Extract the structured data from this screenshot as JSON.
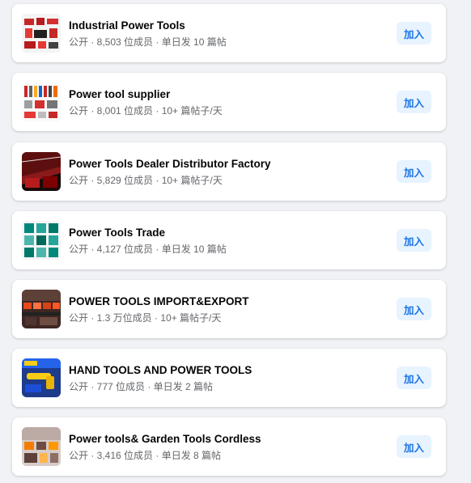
{
  "groups": [
    {
      "name": "Industrial Power Tools",
      "meta": "公开 · 8,503 位成员 · 单日发 10 篇帖",
      "join_label": "加入",
      "thumb_icon": "industrial-power-tools-photo"
    },
    {
      "name": "Power tool supplier",
      "meta": "公开 · 8,001 位成员 · 10+ 篇帖子/天",
      "join_label": "加入",
      "thumb_icon": "tool-assortment-photo"
    },
    {
      "name": "Power Tools Dealer Distributor Factory",
      "meta": "公开 · 5,829 位成员 · 10+ 篇帖子/天",
      "join_label": "加入",
      "thumb_icon": "red-factory-photo"
    },
    {
      "name": "Power Tools Trade",
      "meta": "公开 · 4,127 位成员 · 单日发 10 篇帖",
      "join_label": "加入",
      "thumb_icon": "power-tools-grid-photo"
    },
    {
      "name": "POWER TOOLS IMPORT&EXPORT",
      "meta": "公开 · 1.3 万位成员 · 10+ 篇帖子/天",
      "join_label": "加入",
      "thumb_icon": "factory-line-photo"
    },
    {
      "name": "HAND TOOLS AND POWER TOOLS",
      "meta": "公开 · 777 位成员 · 单日发 2 篇帖",
      "join_label": "加入",
      "thumb_icon": "tools-banner-photo"
    },
    {
      "name": "Power tools& Garden Tools Cordless",
      "meta": "公开 · 3,416 位成员 · 单日发 8 篇帖",
      "join_label": "加入",
      "thumb_icon": "garden-tools-photo"
    }
  ],
  "colors": {
    "page_bg": "#f0f2f5",
    "card_bg": "#ffffff",
    "title": "#050505",
    "meta": "#65676b",
    "join_bg": "#e7f3ff",
    "join_text": "#1b74e4"
  }
}
